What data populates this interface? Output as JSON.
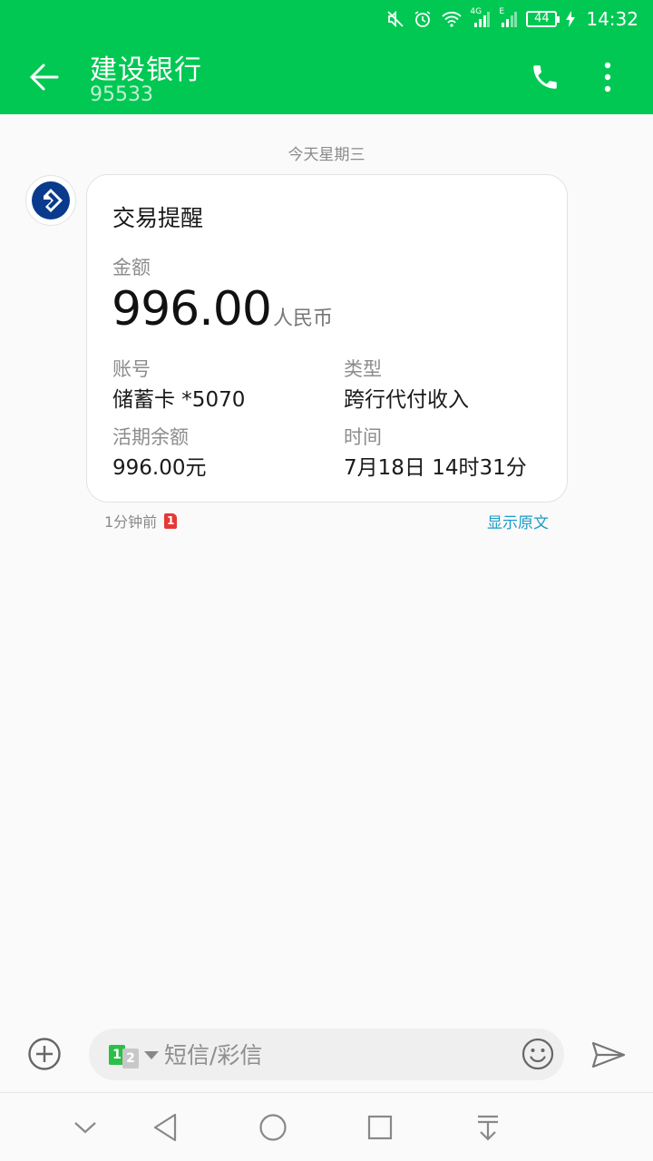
{
  "status_bar": {
    "time": "14:32",
    "battery": "44",
    "network_labels": [
      "4G",
      "E"
    ],
    "icons": [
      "mute-icon",
      "alarm-icon",
      "wifi-icon",
      "signal-icon",
      "signal-icon",
      "battery-icon",
      "charging-icon"
    ]
  },
  "header": {
    "contact_name": "建设银行",
    "contact_number": "95533",
    "icons": [
      "back-arrow-icon",
      "phone-icon",
      "more-vertical-icon"
    ],
    "color": "#00c853"
  },
  "conversation": {
    "date_separator": "今天星期三",
    "message": {
      "title": "交易提醒",
      "amount_label": "金额",
      "amount_value": "996.00",
      "amount_unit": "人民币",
      "fields": [
        {
          "label": "账号",
          "value": "储蓄卡 *5070"
        },
        {
          "label": "类型",
          "value": "跨行代付收入"
        },
        {
          "label": "活期余额",
          "value": "996.00元"
        },
        {
          "label": "时间",
          "value": "7月18日 14时31分"
        }
      ],
      "timestamp": "1分钟前",
      "sim_badge": "1",
      "show_original": "显示原文"
    }
  },
  "composer": {
    "placeholder": "短信/彩信",
    "sim1": "1",
    "sim2": "2",
    "icons": [
      "add-circle-icon",
      "emoji-icon",
      "send-icon"
    ]
  },
  "navbar": {
    "icons": [
      "collapse-down-icon",
      "back-triangle-icon",
      "home-circle-icon",
      "recents-square-icon",
      "notification-pull-icon"
    ]
  },
  "colors": {
    "accent": "#00c853",
    "link": "#1a9bc7",
    "sim_red": "#e53935",
    "bank_blue": "#0a3a8c"
  }
}
